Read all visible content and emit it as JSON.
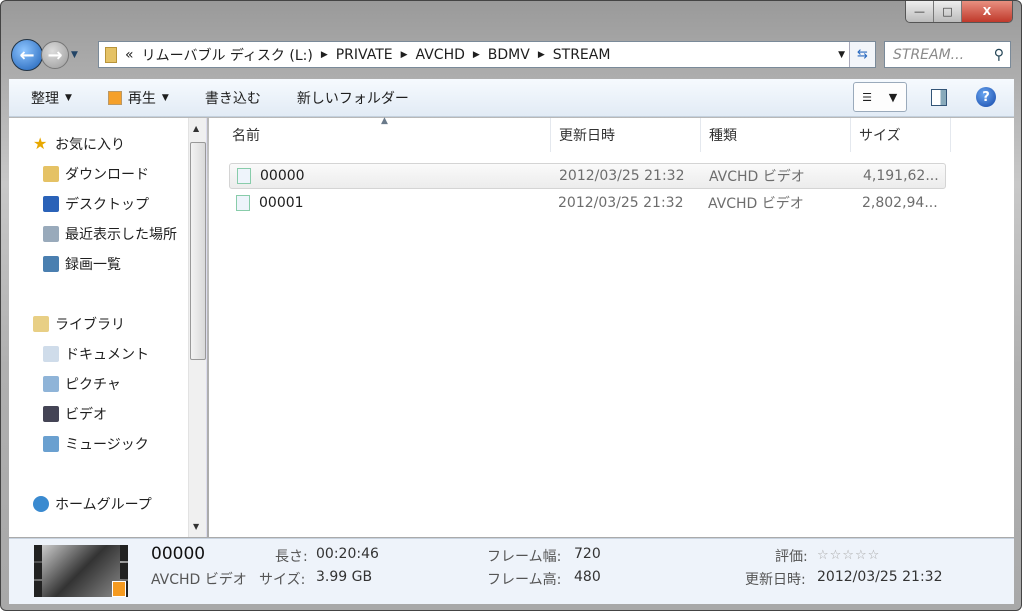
{
  "window": {
    "minimize": "—",
    "maximize": "□",
    "close": "X"
  },
  "address": {
    "overflow": "«",
    "crumbs": [
      "リムーバブル ディスク (L:)",
      "PRIVATE",
      "AVCHD",
      "BDMV",
      "STREAM"
    ]
  },
  "search": {
    "placeholder": "STREAM..."
  },
  "toolbar": {
    "organize": "整理",
    "play": "再生",
    "burn": "書き込む",
    "new_folder": "新しいフォルダー"
  },
  "sidebar": {
    "favorites": {
      "label": "お気に入り",
      "items": [
        "ダウンロード",
        "デスクトップ",
        "最近表示した場所",
        "録画一覧"
      ]
    },
    "libraries": {
      "label": "ライブラリ",
      "items": [
        "ドキュメント",
        "ピクチャ",
        "ビデオ",
        "ミュージック"
      ]
    },
    "homegroup": "ホームグループ"
  },
  "columns": {
    "name": "名前",
    "modified": "更新日時",
    "type": "種類",
    "size": "サイズ"
  },
  "files": [
    {
      "name": "00000",
      "modified": "2012/03/25 21:32",
      "type": "AVCHD ビデオ",
      "size": "4,191,62..."
    },
    {
      "name": "00001",
      "modified": "2012/03/25 21:32",
      "type": "AVCHD ビデオ",
      "size": "2,802,94..."
    }
  ],
  "details": {
    "name": "00000",
    "type": "AVCHD ビデオ",
    "length_label": "長さ:",
    "length": "00:20:46",
    "size_label": "サイズ:",
    "size": "3.99 GB",
    "width_label": "フレーム幅:",
    "width": "720",
    "height_label": "フレーム高:",
    "height": "480",
    "rating_label": "評価:",
    "rating": "☆☆☆☆☆",
    "modified_label": "更新日時:",
    "modified": "2012/03/25 21:32"
  }
}
